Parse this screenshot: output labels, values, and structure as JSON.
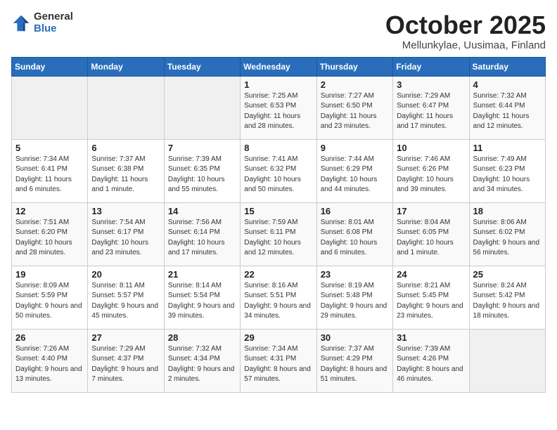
{
  "header": {
    "logo_general": "General",
    "logo_blue": "Blue",
    "month_title": "October 2025",
    "subtitle": "Mellunkylae, Uusimaa, Finland"
  },
  "days_of_week": [
    "Sunday",
    "Monday",
    "Tuesday",
    "Wednesday",
    "Thursday",
    "Friday",
    "Saturday"
  ],
  "weeks": [
    [
      {
        "day": "",
        "sunrise": "",
        "sunset": "",
        "daylight": ""
      },
      {
        "day": "",
        "sunrise": "",
        "sunset": "",
        "daylight": ""
      },
      {
        "day": "",
        "sunrise": "",
        "sunset": "",
        "daylight": ""
      },
      {
        "day": "1",
        "sunrise": "7:25 AM",
        "sunset": "6:53 PM",
        "daylight": "11 hours and 28 minutes."
      },
      {
        "day": "2",
        "sunrise": "7:27 AM",
        "sunset": "6:50 PM",
        "daylight": "11 hours and 23 minutes."
      },
      {
        "day": "3",
        "sunrise": "7:29 AM",
        "sunset": "6:47 PM",
        "daylight": "11 hours and 17 minutes."
      },
      {
        "day": "4",
        "sunrise": "7:32 AM",
        "sunset": "6:44 PM",
        "daylight": "11 hours and 12 minutes."
      }
    ],
    [
      {
        "day": "5",
        "sunrise": "7:34 AM",
        "sunset": "6:41 PM",
        "daylight": "11 hours and 6 minutes."
      },
      {
        "day": "6",
        "sunrise": "7:37 AM",
        "sunset": "6:38 PM",
        "daylight": "11 hours and 1 minute."
      },
      {
        "day": "7",
        "sunrise": "7:39 AM",
        "sunset": "6:35 PM",
        "daylight": "10 hours and 55 minutes."
      },
      {
        "day": "8",
        "sunrise": "7:41 AM",
        "sunset": "6:32 PM",
        "daylight": "10 hours and 50 minutes."
      },
      {
        "day": "9",
        "sunrise": "7:44 AM",
        "sunset": "6:29 PM",
        "daylight": "10 hours and 44 minutes."
      },
      {
        "day": "10",
        "sunrise": "7:46 AM",
        "sunset": "6:26 PM",
        "daylight": "10 hours and 39 minutes."
      },
      {
        "day": "11",
        "sunrise": "7:49 AM",
        "sunset": "6:23 PM",
        "daylight": "10 hours and 34 minutes."
      }
    ],
    [
      {
        "day": "12",
        "sunrise": "7:51 AM",
        "sunset": "6:20 PM",
        "daylight": "10 hours and 28 minutes."
      },
      {
        "day": "13",
        "sunrise": "7:54 AM",
        "sunset": "6:17 PM",
        "daylight": "10 hours and 23 minutes."
      },
      {
        "day": "14",
        "sunrise": "7:56 AM",
        "sunset": "6:14 PM",
        "daylight": "10 hours and 17 minutes."
      },
      {
        "day": "15",
        "sunrise": "7:59 AM",
        "sunset": "6:11 PM",
        "daylight": "10 hours and 12 minutes."
      },
      {
        "day": "16",
        "sunrise": "8:01 AM",
        "sunset": "6:08 PM",
        "daylight": "10 hours and 6 minutes."
      },
      {
        "day": "17",
        "sunrise": "8:04 AM",
        "sunset": "6:05 PM",
        "daylight": "10 hours and 1 minute."
      },
      {
        "day": "18",
        "sunrise": "8:06 AM",
        "sunset": "6:02 PM",
        "daylight": "9 hours and 56 minutes."
      }
    ],
    [
      {
        "day": "19",
        "sunrise": "8:09 AM",
        "sunset": "5:59 PM",
        "daylight": "9 hours and 50 minutes."
      },
      {
        "day": "20",
        "sunrise": "8:11 AM",
        "sunset": "5:57 PM",
        "daylight": "9 hours and 45 minutes."
      },
      {
        "day": "21",
        "sunrise": "8:14 AM",
        "sunset": "5:54 PM",
        "daylight": "9 hours and 39 minutes."
      },
      {
        "day": "22",
        "sunrise": "8:16 AM",
        "sunset": "5:51 PM",
        "daylight": "9 hours and 34 minutes."
      },
      {
        "day": "23",
        "sunrise": "8:19 AM",
        "sunset": "5:48 PM",
        "daylight": "9 hours and 29 minutes."
      },
      {
        "day": "24",
        "sunrise": "8:21 AM",
        "sunset": "5:45 PM",
        "daylight": "9 hours and 23 minutes."
      },
      {
        "day": "25",
        "sunrise": "8:24 AM",
        "sunset": "5:42 PM",
        "daylight": "9 hours and 18 minutes."
      }
    ],
    [
      {
        "day": "26",
        "sunrise": "7:26 AM",
        "sunset": "4:40 PM",
        "daylight": "9 hours and 13 minutes."
      },
      {
        "day": "27",
        "sunrise": "7:29 AM",
        "sunset": "4:37 PM",
        "daylight": "9 hours and 7 minutes."
      },
      {
        "day": "28",
        "sunrise": "7:32 AM",
        "sunset": "4:34 PM",
        "daylight": "9 hours and 2 minutes."
      },
      {
        "day": "29",
        "sunrise": "7:34 AM",
        "sunset": "4:31 PM",
        "daylight": "8 hours and 57 minutes."
      },
      {
        "day": "30",
        "sunrise": "7:37 AM",
        "sunset": "4:29 PM",
        "daylight": "8 hours and 51 minutes."
      },
      {
        "day": "31",
        "sunrise": "7:39 AM",
        "sunset": "4:26 PM",
        "daylight": "8 hours and 46 minutes."
      },
      {
        "day": "",
        "sunrise": "",
        "sunset": "",
        "daylight": ""
      }
    ]
  ]
}
